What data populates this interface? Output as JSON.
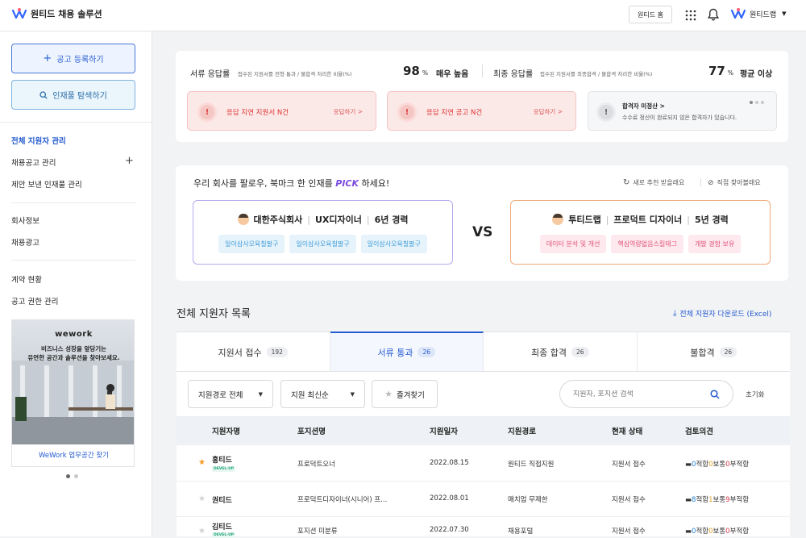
{
  "header": {
    "logo_text": "원티드 채용 솔루션",
    "home_button": "원티드 홈",
    "company_name": "원티드랩"
  },
  "sidebar": {
    "primary_button": "공고 등록하기",
    "secondary_button": "인재풀 탐색하기",
    "items": [
      "전체 지원자 관리",
      "채용공고 관리",
      "제안 보낸 인재풀 관리",
      "회사정보",
      "채용광고",
      "계약 현황",
      "공고 권한 관리"
    ],
    "banner": {
      "logo": "wework",
      "line1": "비즈니스 성장을 앞당기는",
      "line2": "유연한 공간과 솔루션을 찾아보세요.",
      "link": "WeWork 업무공간 찾기"
    }
  },
  "rates": {
    "doc": {
      "label": "서류 응답률",
      "desc": "접수된 지원서를 전형 통과 / 불합격 처리한 비율(%)",
      "value": "98",
      "unit": "%",
      "grade": "매우 높음"
    },
    "final": {
      "label": "최종 응답률",
      "desc": "접수된 지원서를 최종합격 / 불합격 처리한 비율(%)",
      "value": "77",
      "unit": "%",
      "grade": "평균 이상"
    }
  },
  "alerts": [
    {
      "title": "응답 지연 지원서 N건",
      "action": "응답하기 >"
    },
    {
      "title": "응답 지연 공고 N건",
      "action": "응답하기 >"
    }
  ],
  "notice": {
    "title": "합격자 미정산 >",
    "desc": "수수료 정산이 완료되지 않은 합격자가 있습니다."
  },
  "pick": {
    "title_before": "우리 회사를 팔로우, 북마크 한 인재를 ",
    "pick_word": "PICK",
    "title_after": " 하세요!",
    "action1": "새로 추천 받을래요",
    "action2": "직접 찾아볼래요",
    "vs": "VS",
    "left": {
      "company": "대한주식회사",
      "role": "UX디자이너",
      "exp": "6년 경력",
      "tags": [
        "일이삼사오육칠팔구",
        "일이삼사오육칠팔구",
        "일이삼사오육칠팔구"
      ]
    },
    "right": {
      "company": "투티드랩",
      "role": "프로덕트 디자이너",
      "exp": "5년 경력",
      "tags": [
        "데이터 분석 및 개선",
        "핵심역량없음스킬태그",
        "개발 경험 보유"
      ]
    }
  },
  "list": {
    "title": "전체 지원자 목록",
    "download": "전체 지원자 다운로드 (Excel)",
    "tabs": [
      {
        "label": "지원서 접수",
        "count": "192"
      },
      {
        "label": "서류 통과",
        "count": "26"
      },
      {
        "label": "최종 합격",
        "count": "26"
      },
      {
        "label": "불합격",
        "count": "26"
      }
    ],
    "filters": {
      "route": "지원경로 전체",
      "sort": "지원 최신순",
      "favorite": "즐겨찾기",
      "search_placeholder": "지원자, 포지션 검색",
      "reset": "초기화"
    },
    "columns": [
      "지원자명",
      "포지션명",
      "지원일자",
      "지원경로",
      "현재 상태",
      "검토의견"
    ],
    "rows": [
      {
        "name": "홍티드",
        "badge": "DEVEL-UP",
        "position": "프로덕트오너",
        "date": "2022.08.15",
        "route": "원티드 직접지원",
        "status": "지원서 접수",
        "ok_label": "적합",
        "ok": "0",
        "mid_label": "보통",
        "mid": "0",
        "no_label": "부적합",
        "no": "0",
        "starred": true
      },
      {
        "name": "권티드",
        "badge": "",
        "position": "프로덕트디자이너(시니어) 프...",
        "date": "2022.08.01",
        "route": "매치업 무제한",
        "status": "지원서 접수",
        "ok_label": "적합",
        "ok": "8",
        "mid_label": "보통",
        "mid": "1",
        "no_label": "부적합",
        "no": "9",
        "starred": false
      },
      {
        "name": "김티드",
        "badge": "DEVEL-UP",
        "position": "포지션 미분류",
        "date": "2022.07.30",
        "route": "채용포털",
        "status": "지원서 접수",
        "ok_label": "적합",
        "ok": "0",
        "mid_label": "보통",
        "mid": "0",
        "no_label": "부적합",
        "no": "0",
        "starred": false
      }
    ]
  }
}
